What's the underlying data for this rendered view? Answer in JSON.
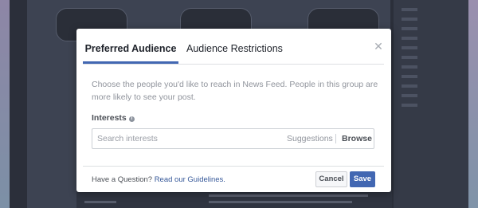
{
  "dialog": {
    "tabs": [
      {
        "label": "Preferred Audience",
        "active": true
      },
      {
        "label": "Audience Restrictions",
        "active": false
      }
    ],
    "close_icon": "close-icon",
    "description": "Choose the people you'd like to reach in News Feed. People in this group are more likely to see your post.",
    "interests": {
      "label": "Interests",
      "info_icon": "info-icon",
      "search_placeholder": "Search interests",
      "suggestions_label": "Suggestions",
      "browse_label": "Browse"
    },
    "footer": {
      "question_text": "Have a Question?",
      "guidelines_link": "Read our Guidelines.",
      "cancel_label": "Cancel",
      "save_label": "Save"
    }
  },
  "colors": {
    "accent": "#4267b2",
    "link": "#365899",
    "overlay": "#4a5068"
  }
}
